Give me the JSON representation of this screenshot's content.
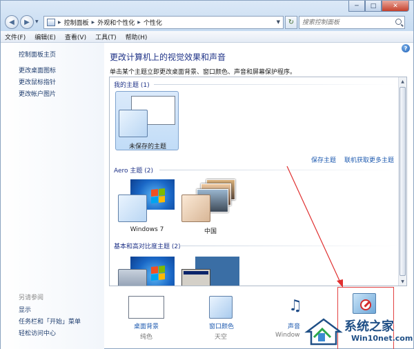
{
  "window": {
    "nav_back": "◀",
    "nav_forward": "▶",
    "min_label": "─",
    "max_label": "□",
    "close_label": "✕"
  },
  "address": {
    "crumbs": [
      "控制面板",
      "外观和个性化",
      "个性化"
    ]
  },
  "search": {
    "placeholder": "搜索控制面板"
  },
  "menu": [
    "文件(F)",
    "编辑(E)",
    "查看(V)",
    "工具(T)",
    "帮助(H)"
  ],
  "sidebar": {
    "home": "控制面板主页",
    "links": [
      "更改桌面图标",
      "更改鼠标指针",
      "更改帐户图片"
    ],
    "see_also_heading": "另请参阅",
    "see_also": [
      "显示",
      "任务栏和「开始」菜单",
      "轻松访问中心"
    ]
  },
  "main": {
    "title": "更改计算机上的视觉效果和声音",
    "description": "单击某个主题立即更改桌面背景、窗口颜色、声音和屏幕保护程序。",
    "help_label": "?"
  },
  "themes": {
    "my_themes_header": "我的主题 (1)",
    "unsaved_theme": "未保存的主题",
    "save_theme": "保存主题",
    "get_more_online": "联机获取更多主题",
    "aero_header": "Aero 主题 (2)",
    "aero_items": [
      "Windows 7",
      "中国"
    ],
    "basic_header": "基本和高对比度主题 (2)"
  },
  "bottom": {
    "desktop_bg_label": "桌面背景",
    "desktop_bg_sub": "纯色",
    "window_color_label": "窗口颜色",
    "window_color_sub": "天空",
    "sound_label": "声音",
    "sound_sub": "Window"
  },
  "watermark": {
    "line1": "系统之家",
    "line2": "Win10net.com"
  },
  "colors": {
    "link": "#1f5bb0",
    "title_blue": "#1e3287",
    "highlight_red": "#e24040"
  }
}
